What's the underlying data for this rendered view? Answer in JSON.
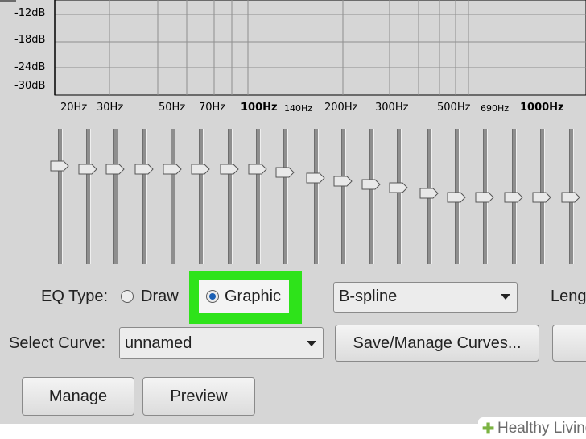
{
  "graph": {
    "db_labels": [
      "-12dB",
      "-18dB",
      "-24dB",
      "-30dB"
    ],
    "freq_labels": [
      "20Hz",
      "30Hz",
      "50Hz",
      "70Hz",
      "100Hz",
      "140Hz",
      "200Hz",
      "300Hz",
      "500Hz",
      "690Hz",
      "1000Hz"
    ]
  },
  "sliders": {
    "count": 20
  },
  "eq_type": {
    "label": "EQ Type:",
    "draw_label": "Draw",
    "graphic_label": "Graphic",
    "selected": "Graphic"
  },
  "interpolation": {
    "value": "B-spline"
  },
  "length": {
    "label": "Leng"
  },
  "curve": {
    "label": "Select Curve:",
    "value": "unnamed",
    "save_manage_label": "Save/Manage Curves..."
  },
  "buttons": {
    "manage_label": "Manage",
    "preview_label": "Preview"
  },
  "watermark": {
    "brand": "Healthy Living"
  },
  "colors": {
    "highlight": "#2ee31a",
    "background": "#d6d6d6",
    "radio_dot": "#1a5fb4"
  }
}
